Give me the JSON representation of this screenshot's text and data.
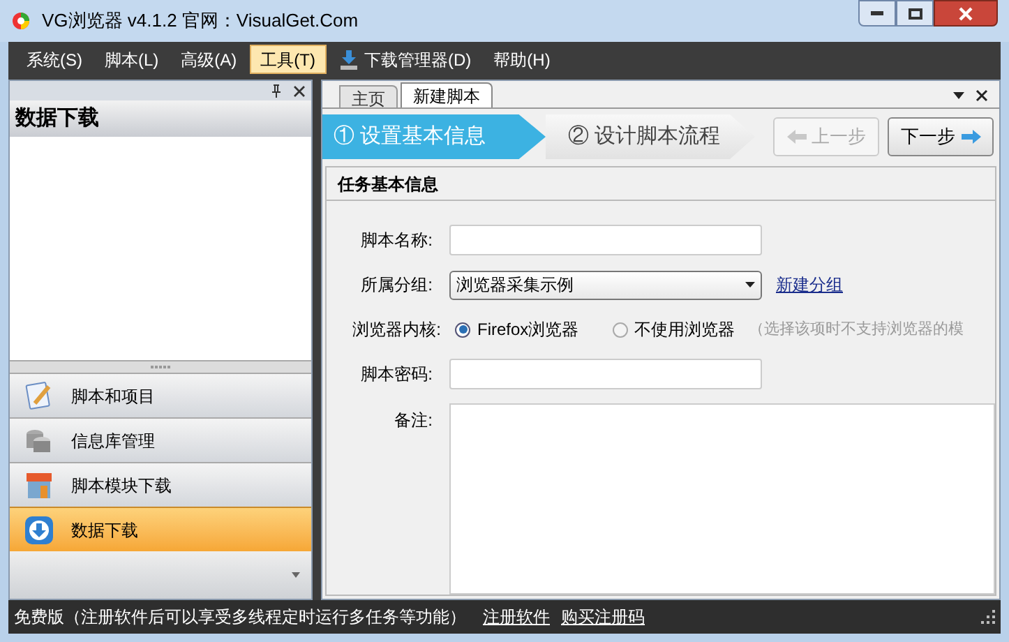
{
  "window": {
    "title": "VG浏览器 v4.1.2 官网：VisualGet.Com"
  },
  "menu": [
    {
      "label": "系统(S)",
      "selected": false
    },
    {
      "label": "脚本(L)",
      "selected": false
    },
    {
      "label": "高级(A)",
      "selected": false
    },
    {
      "label": "工具(T)",
      "selected": true
    },
    {
      "label": "下载管理器(D)",
      "selected": false,
      "kind": "download"
    },
    {
      "label": "帮助(H)",
      "selected": false
    }
  ],
  "left_panel": {
    "title": "数据下载",
    "nav": [
      {
        "label": "脚本和项目",
        "selected": false,
        "kind": "notepad"
      },
      {
        "label": "信息库管理",
        "selected": false,
        "kind": "database"
      },
      {
        "label": "脚本模块下载",
        "selected": false,
        "kind": "shop"
      },
      {
        "label": "数据下载",
        "selected": true,
        "kind": "download"
      }
    ]
  },
  "tabs": [
    {
      "label": "主页",
      "selected": false
    },
    {
      "label": "新建脚本",
      "selected": true
    }
  ],
  "steps": [
    {
      "label": "① 设置基本信息",
      "selected": true
    },
    {
      "label": "② 设计脚本流程",
      "selected": false
    }
  ],
  "buttons": [
    {
      "label": "上一步",
      "disabled": true,
      "kind": "back"
    },
    {
      "label": "下一步",
      "disabled": false,
      "kind": "next"
    }
  ],
  "section_title": "任务基本信息",
  "form": {
    "name_label": "脚本名称:",
    "group_label": "所属分组:",
    "group_value": "浏览器采集示例",
    "group_link": "新建分组",
    "engine_label": "浏览器内核:",
    "engine_options": [
      {
        "label": "Firefox浏览器",
        "selected": true
      },
      {
        "label": "不使用浏览器",
        "selected": false
      }
    ],
    "engine_hint": "（选择该项时不支持浏览器的模",
    "password_label": "脚本密码:",
    "notes_label": "备注:"
  },
  "status_bar": {
    "text": "免费版（注册软件后可以享受多线程定时运行多任务等功能）",
    "links": [
      "注册软件",
      "购买注册码"
    ]
  }
}
